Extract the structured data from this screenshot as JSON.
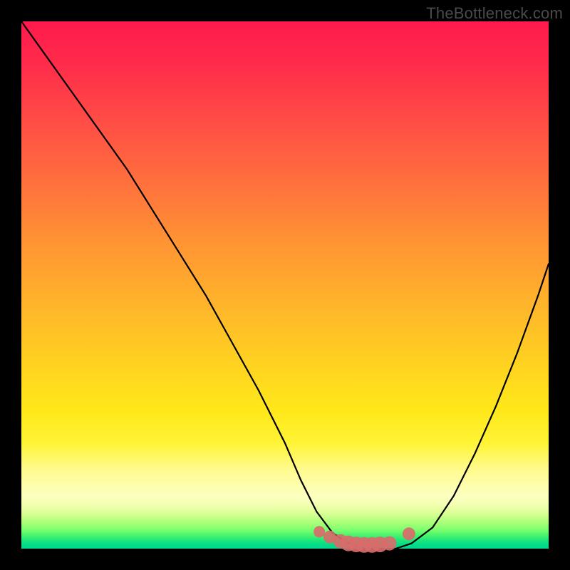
{
  "watermark": "TheBottleneck.com",
  "colors": {
    "frame": "#000000",
    "curve_stroke": "#000000",
    "marker_fill": "#d86b6b",
    "marker_stroke": "#d86b6b"
  },
  "chart_data": {
    "type": "line",
    "title": "",
    "xlabel": "",
    "ylabel": "",
    "xlim": [
      0,
      100
    ],
    "ylim": [
      0,
      100
    ],
    "grid": false,
    "legend": false,
    "series": [
      {
        "name": "bottleneck-curve",
        "x": [
          0,
          5,
          10,
          15,
          20,
          25,
          30,
          35,
          40,
          45,
          50,
          53,
          56,
          59,
          62,
          65,
          68,
          71,
          74,
          78,
          82,
          86,
          90,
          94,
          98,
          100
        ],
        "y": [
          100,
          93,
          86,
          79,
          72,
          64,
          56,
          48,
          39,
          30,
          20,
          13,
          7,
          3,
          1,
          0,
          0,
          0,
          1,
          4,
          10,
          18,
          27,
          37,
          48,
          54
        ]
      }
    ],
    "markers": {
      "name": "optimal-range",
      "x": [
        56.5,
        58.5,
        60.5,
        62.0,
        63.5,
        65.0,
        66.5,
        68.0,
        69.8,
        73.5
      ],
      "y": [
        3.2,
        2.2,
        1.4,
        1.0,
        0.8,
        0.7,
        0.7,
        0.8,
        1.0,
        2.8
      ],
      "r": [
        8,
        9,
        10,
        11,
        11,
        11,
        11,
        11,
        10,
        9
      ]
    },
    "gradient_stops": [
      {
        "pos": 0.0,
        "color": "#ff1a4d"
      },
      {
        "pos": 0.3,
        "color": "#ff6e3e"
      },
      {
        "pos": 0.66,
        "color": "#ffd51f"
      },
      {
        "pos": 0.85,
        "color": "#fffb8e"
      },
      {
        "pos": 1.0,
        "color": "#03d68c"
      }
    ]
  }
}
